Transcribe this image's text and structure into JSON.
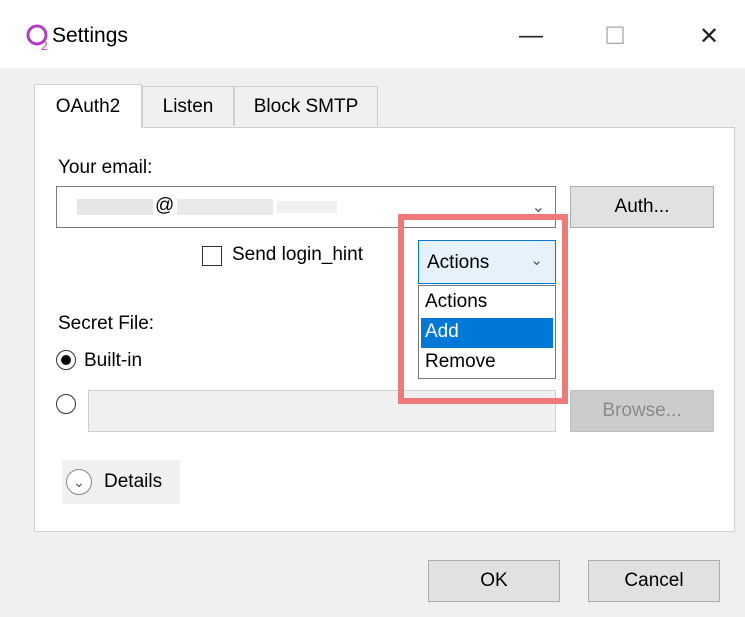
{
  "window": {
    "title": "Settings",
    "icon": "o2-app-icon",
    "controls": {
      "minimize": "—",
      "maximize": "☐",
      "close": "✕"
    }
  },
  "tabs": [
    {
      "label": "OAuth2",
      "active": true
    },
    {
      "label": "Listen",
      "active": false
    },
    {
      "label": "Block SMTP",
      "active": false
    }
  ],
  "oauth": {
    "email_label": "Your email:",
    "email_at": "@",
    "auth_button": "Auth...",
    "send_login_hint_label": "Send login_hint",
    "send_login_hint_checked": false,
    "actions": {
      "selected": "Actions",
      "options": [
        "Actions",
        "Add",
        "Remove"
      ],
      "highlighted_option": "Add"
    },
    "secret_file_label": "Secret File:",
    "secret_builtin_label": "Built-in",
    "secret_builtin_selected": true,
    "browse_button": "Browse...",
    "details_label": "Details"
  },
  "footer": {
    "ok_button": "OK",
    "cancel_button": "Cancel"
  },
  "colors": {
    "accent": "#0078d7",
    "highlight_border": "#f07a7a",
    "app_icon_color": "#b23cc4"
  }
}
